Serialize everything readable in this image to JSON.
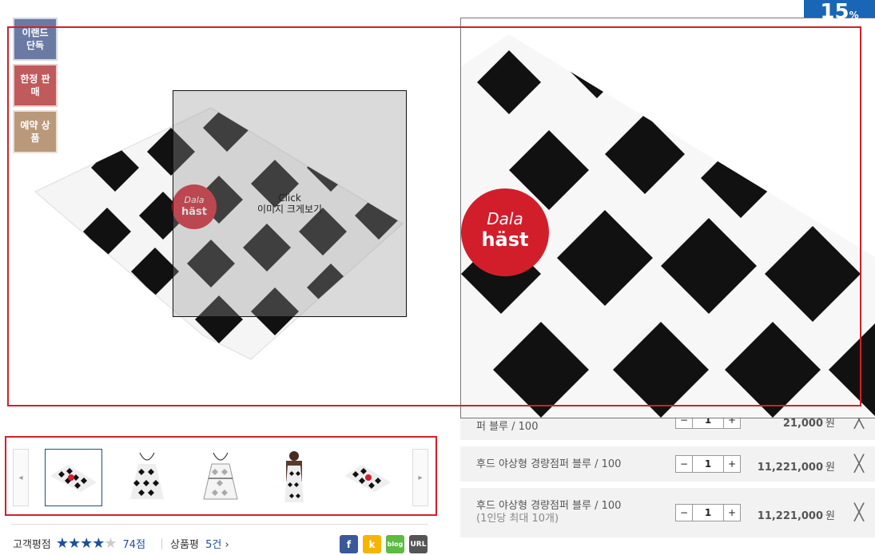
{
  "badges": {
    "exclusive": "이랜드 단독",
    "limited": "한정 판매",
    "preorder": "예약 상품"
  },
  "lens": {
    "title": "Click",
    "subtitle": "이미지 크게보기"
  },
  "product_logo": {
    "line1": "Dala",
    "line2": "häst"
  },
  "discount": {
    "value": "15",
    "unit": "%"
  },
  "thumbnails": {
    "prev": "◂",
    "next": "▸"
  },
  "rating": {
    "label": "고객평점",
    "stars": "★★★★",
    "empty_star": "★",
    "score": "74점",
    "review_label": "상품평",
    "review_count": "5건",
    "review_arrow": "›"
  },
  "share": {
    "facebook": "f",
    "kakaostory": "k",
    "blog": "blog",
    "url": "URL"
  },
  "options": [
    {
      "name": "퍼 블루 / 100",
      "qty": "1",
      "price": "21,000",
      "unit": "원"
    },
    {
      "name": "후드 야상형 경량점퍼 블루 / 100",
      "qty": "1",
      "price": "11,221,000",
      "unit": "원"
    },
    {
      "name": "후드 야상형 경량점퍼 블루 / 100",
      "note": "(1인당 최대 10개)",
      "qty": "1",
      "price": "11,221,000",
      "unit": "원"
    }
  ],
  "qty_controls": {
    "minus": "−",
    "plus": "+",
    "remove": "╳"
  }
}
